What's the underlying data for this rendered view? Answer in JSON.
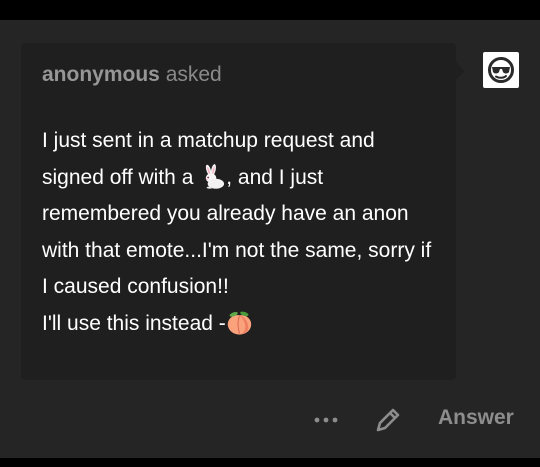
{
  "colors": {
    "background": "#252525",
    "card": "#1f1f1f",
    "text": "#ffffff",
    "muted": "#8d8d8d"
  },
  "ask": {
    "asker": "anonymous",
    "verb": "asked",
    "body_line1_before_emoji": "I just sent in a matchup request and signed off with a ",
    "body_line1_after_emoji": ", and I just remembered you already have an anon with that emote...I'm not the same, sorry if I caused confusion!!",
    "body_line2_before_emoji": "I'll use this instead -",
    "emoji_1": "rabbit-emoji",
    "emoji_2": "peach-emoji"
  },
  "avatar": {
    "icon": "sunglasses-face-icon"
  },
  "actions": {
    "more_icon": "more-options-icon",
    "edit_icon": "pencil-icon",
    "answer_label": "Answer"
  }
}
